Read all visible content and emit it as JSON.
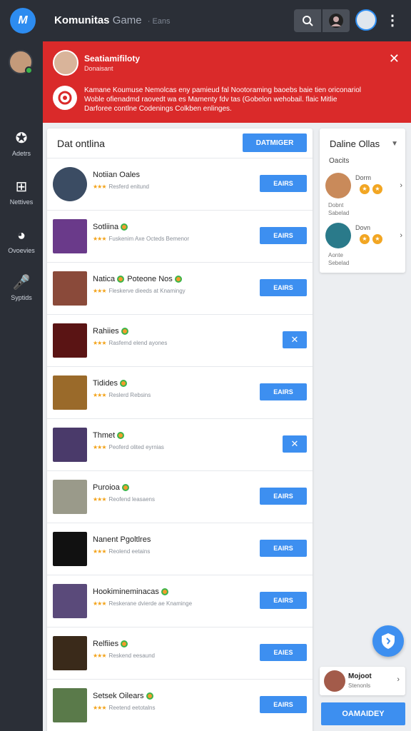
{
  "header": {
    "logo_text": "M",
    "title": "Komunitas",
    "title_suffix": "Game",
    "title_sub": "· Eans",
    "search_icon": "search-icon",
    "more_icon": "more-vertical-icon"
  },
  "rail": {
    "items": [
      {
        "label": "Adetrs",
        "icon": "controller-icon",
        "glyph": "✪"
      },
      {
        "label": "Nettives",
        "icon": "network-icon",
        "glyph": "⊞"
      },
      {
        "label": "Ovoevies",
        "icon": "circle-face-icon",
        "glyph": "◕"
      },
      {
        "label": "Syptids",
        "icon": "microphone-icon",
        "glyph": "🎤"
      }
    ]
  },
  "banner": {
    "title": "Seatiamifiloty",
    "subtitle": "Donaisant",
    "text_lines": [
      "Kamane Koumuse Nemolcas eny pamieud fal Nootoraming baoebs baie tien oriconariol",
      "Woble ofienadmd raovedt wa es Mamenty fdv tas (Gobelon wehobail. flaic Mitlie",
      "Darforee contlne Codenings Colkben enlinges."
    ],
    "close_icon": "close-icon",
    "alert_icon": "alert-icon"
  },
  "main": {
    "title": "Dat ontlina",
    "button_label": "DATMIGER",
    "rows": [
      {
        "name": "Notiian Oales",
        "meta": "Resferd enitund",
        "action": "EAIRS",
        "type": "button",
        "badge": false,
        "thumb": "#3b4c63",
        "round": true
      },
      {
        "name": "Sotliina",
        "meta": "Fuskenim Axe Octeds Bemenor",
        "action": "EAIRS",
        "type": "button",
        "badge": true,
        "thumb": "#6a3a8a",
        "round": false
      },
      {
        "name": "Natica",
        "name2": "Poteone Nos",
        "meta": "Fleskerve dieeds at Knamingy",
        "action": "EAIRS",
        "type": "button",
        "badge": true,
        "thumb": "#8a4a3a",
        "round": false
      },
      {
        "name": "Rahiies",
        "meta": "Rasfemd elend ayones",
        "action": "✕",
        "type": "x",
        "badge": true,
        "thumb": "#5a1414",
        "round": false
      },
      {
        "name": "Tidides",
        "meta": "Reslerd Rebsins",
        "action": "EAIRS",
        "type": "button",
        "badge": true,
        "thumb": "#9a6a2a",
        "round": false
      },
      {
        "name": "Thmet",
        "meta": "Peoferd olited eyrnias",
        "action": "✕",
        "type": "x",
        "badge": true,
        "thumb": "#4a3a6a",
        "round": false
      },
      {
        "name": "Puroioa",
        "meta": "Reofend leasaens",
        "action": "EAIRS",
        "type": "button",
        "badge": true,
        "thumb": "#9a9a8a",
        "round": false
      },
      {
        "name": "Nanent Pgoltlres",
        "meta": "Reolend eetains",
        "action": "EAIRS",
        "type": "button",
        "badge": false,
        "thumb": "#111111",
        "round": false
      },
      {
        "name": "Hookimineminacas",
        "meta": "Reskerane dvierde ae Knaminge",
        "action": "EAIRS",
        "type": "button",
        "badge": true,
        "thumb": "#5a4a7a",
        "round": false
      },
      {
        "name": "Relfiies",
        "meta": "Reskend eesaund",
        "action": "EAIES",
        "type": "button",
        "badge": true,
        "thumb": "#3a2a1a",
        "round": false
      },
      {
        "name": "Setsek Oilears",
        "meta": "Reetend eetotalns",
        "action": "EAIRS",
        "type": "button",
        "badge": true,
        "thumb": "#5a7a4a",
        "round": false
      }
    ]
  },
  "side": {
    "title": "Daline Ollas",
    "label": "Oacits",
    "users": [
      {
        "name": "Dorm",
        "sub1": "Dobnt",
        "sub2": "Sabelad",
        "avatar": "#c98a5a"
      },
      {
        "name": "Dovn",
        "sub1": "Aonte",
        "sub2": "Sebelad",
        "avatar": "#2a7a8a"
      }
    ]
  },
  "mini": {
    "title": "Mojoot",
    "subtitle": "Stenonls"
  },
  "cta_label": "OAMAIDEY",
  "fab_icon": "shield-icon",
  "accent": "#3d8ff0",
  "banner_color": "#da2a2a"
}
